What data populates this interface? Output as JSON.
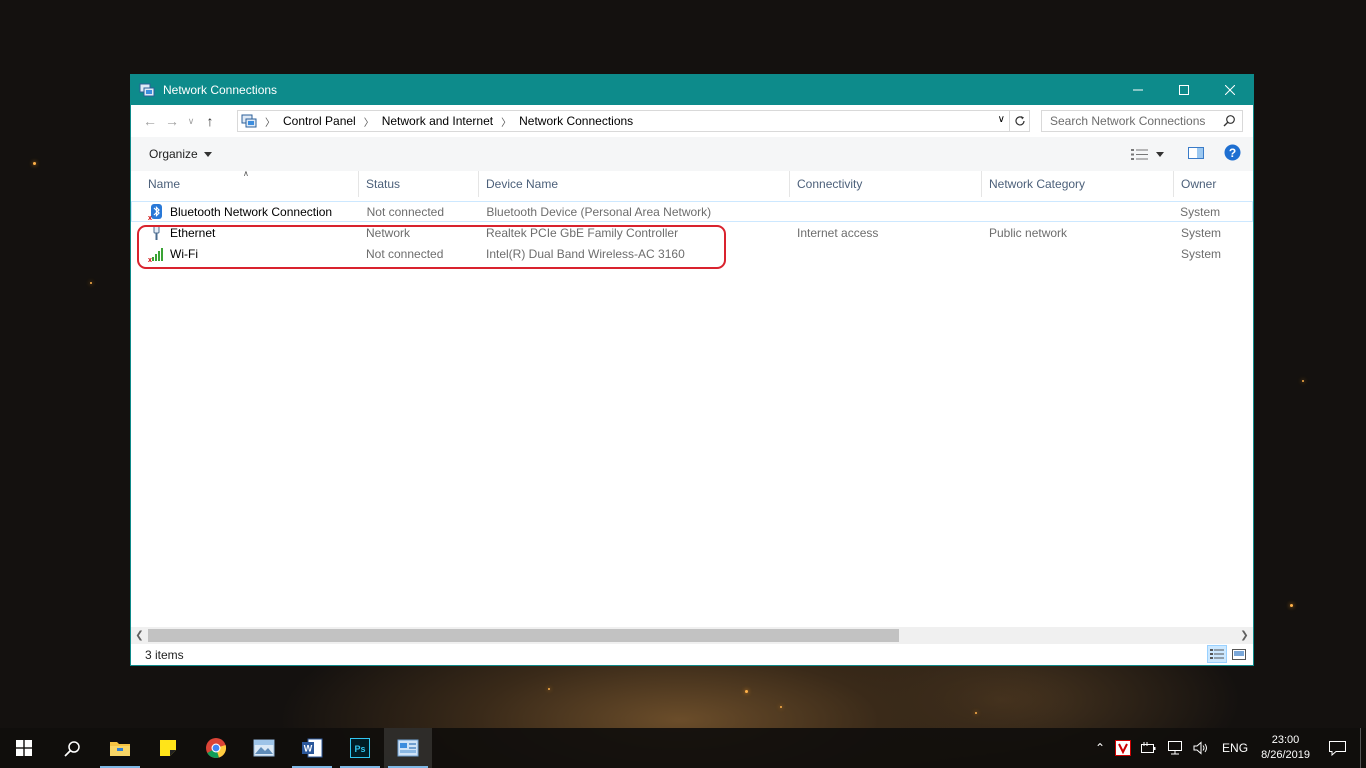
{
  "window": {
    "title": "Network Connections",
    "controls": {
      "minimize": "minimize",
      "maximize": "maximize",
      "close": "close"
    }
  },
  "address": {
    "crumbs": [
      "Control Panel",
      "Network and Internet",
      "Network Connections"
    ],
    "search_placeholder": "Search Network Connections"
  },
  "toolbar": {
    "organize_label": "Organize"
  },
  "columns": [
    "Name",
    "Status",
    "Device Name",
    "Connectivity",
    "Network Category",
    "Owner"
  ],
  "rows": [
    {
      "name": "Bluetooth Network Connection",
      "status": "Not connected",
      "device": "Bluetooth Device (Personal Area Network)",
      "connectivity": "",
      "category": "",
      "owner": "System",
      "icon": "bluetooth-icon"
    },
    {
      "name": "Ethernet",
      "status": "Network",
      "device": "Realtek PCIe GbE Family Controller",
      "connectivity": "Internet access",
      "category": "Public network",
      "owner": "System",
      "icon": "ethernet-icon"
    },
    {
      "name": "Wi-Fi",
      "status": "Not connected",
      "device": "Intel(R) Dual Band Wireless-AC 3160",
      "connectivity": "",
      "category": "",
      "owner": "System",
      "icon": "wifi-icon"
    }
  ],
  "statusbar": {
    "count": "3 items"
  },
  "taskbar": {
    "language": "ENG",
    "time": "23:00",
    "date": "8/26/2019"
  },
  "colors": {
    "titlebar": "#0d8b8b",
    "highlight_box": "#d9232e",
    "header_text": "#4c607a"
  }
}
